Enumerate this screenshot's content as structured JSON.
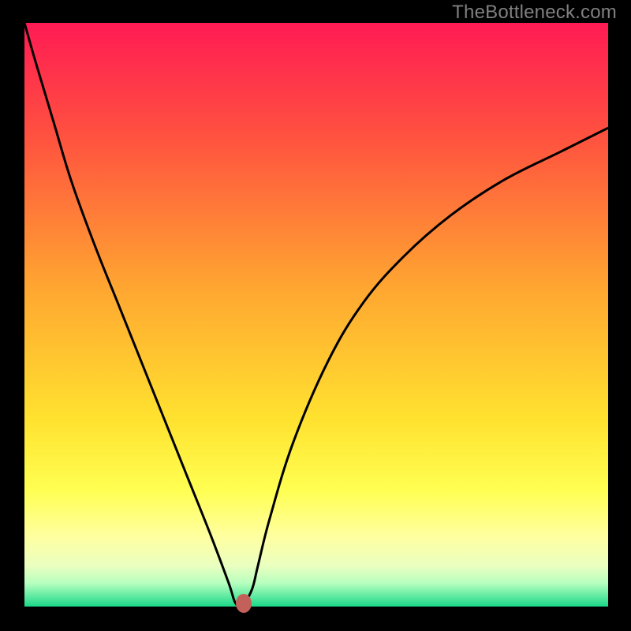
{
  "watermark": {
    "text": "TheBottleneck.com"
  },
  "chart_data": {
    "type": "line",
    "title": "",
    "xlabel": "",
    "ylabel": "",
    "x_range": [
      0,
      100
    ],
    "y_range": [
      0,
      100
    ],
    "gradient_stops": [
      {
        "pos": 0,
        "color": "#ff1b54"
      },
      {
        "pos": 20,
        "color": "#ff533f"
      },
      {
        "pos": 45,
        "color": "#ffa531"
      },
      {
        "pos": 68,
        "color": "#ffe22f"
      },
      {
        "pos": 80,
        "color": "#ffff52"
      },
      {
        "pos": 88,
        "color": "#ffffa0"
      },
      {
        "pos": 93,
        "color": "#eaffc0"
      },
      {
        "pos": 96,
        "color": "#b7ffbf"
      },
      {
        "pos": 100,
        "color": "#1bd989"
      }
    ],
    "series": [
      {
        "name": "bottleneck-curve",
        "x": [
          0,
          2,
          5,
          8,
          12,
          16,
          20,
          24,
          28,
          32,
          35,
          36.2,
          37.5,
          39,
          40,
          42,
          46,
          52,
          58,
          65,
          73,
          82,
          92,
          100
        ],
        "y": [
          100,
          93,
          83,
          73,
          62,
          52,
          42,
          32,
          22,
          12,
          4,
          0.5,
          0.5,
          3,
          7,
          15,
          28,
          42,
          52,
          60,
          67,
          73,
          78,
          82
        ]
      }
    ],
    "marker": {
      "x": 37.5,
      "y": 0.5,
      "color": "#c36059"
    },
    "flat_bottom": {
      "x_start": 35.2,
      "x_end": 37.5,
      "y": 0.5
    }
  }
}
